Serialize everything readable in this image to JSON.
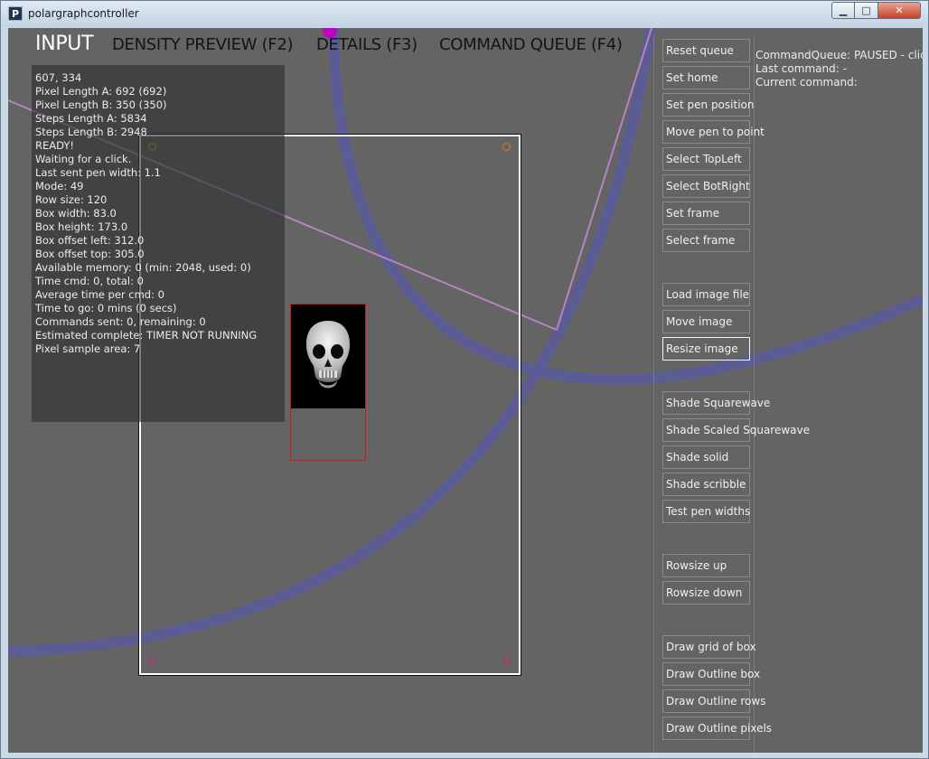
{
  "window": {
    "title": "polargraphcontroller",
    "icon_letter": "P",
    "minimize_glyph": "▁",
    "maximize_glyph": "□",
    "close_glyph": "✕"
  },
  "tabs": [
    {
      "label": "INPUT",
      "active": true
    },
    {
      "label": "DENSITY PREVIEW (F2)",
      "active": false
    },
    {
      "label": "DETAILS (F3)",
      "active": false
    },
    {
      "label": "COMMAND QUEUE (F4)",
      "active": false
    }
  ],
  "info_lines": [
    "607, 334",
    "Pixel Length A: 692 (692)",
    "Pixel Length B: 350 (350)",
    "Steps Length A: 5834",
    "Steps Length B: 2948",
    "READY!",
    "Waiting for a click.",
    "Last sent pen width: 1.1",
    "Mode: 49",
    "Row size: 120",
    "Box width: 83.0",
    "Box height: 173.0",
    "Box offset left: 312.0",
    "Box offset top: 305.0",
    "Available memory: 0 (min: 2048, used: 0)",
    "Time cmd: 0, total: 0",
    "Average time per cmd: 0",
    "Time to go: 0 mins (0 secs)",
    "Commands sent: 0, remaining: 0",
    "Estimated complete: TIMER NOT RUNNING",
    "Pixel sample area: 7"
  ],
  "buttons": [
    {
      "label": "Reset queue"
    },
    {
      "label": "Set home"
    },
    {
      "label": "Set pen position"
    },
    {
      "label": "Move pen to point"
    },
    {
      "label": "Select TopLeft"
    },
    {
      "label": "Select BotRight"
    },
    {
      "label": "Set frame"
    },
    {
      "label": "Select frame"
    },
    {
      "label": "Load image file"
    },
    {
      "label": "Move image"
    },
    {
      "label": "Resize image"
    },
    {
      "label": "Shade Squarewave"
    },
    {
      "label": "Shade Scaled Squarewave"
    },
    {
      "label": "Shade solid"
    },
    {
      "label": "Shade scribble"
    },
    {
      "label": "Test pen widths"
    },
    {
      "label": "Rowsize up"
    },
    {
      "label": "Rowsize down"
    },
    {
      "label": "Draw grid of box"
    },
    {
      "label": "Draw Outline box"
    },
    {
      "label": "Draw Outline rows"
    },
    {
      "label": "Draw Outline pixels"
    }
  ],
  "queue_status": {
    "state": "CommandQueue: PAUSED - click",
    "last_command": "Last command: -",
    "current_command": "Current command:"
  },
  "colors": {
    "canvas": "#646464",
    "arc": "#5a5a9c",
    "cord": "#b883c4",
    "frame": "#ffffff",
    "image_box": "#d01818",
    "corner_top_left": "#c9c900",
    "corner_top_right": "#e07a1a",
    "corner_bottom": "#c8207a",
    "pen_marker": "#c200c2"
  }
}
